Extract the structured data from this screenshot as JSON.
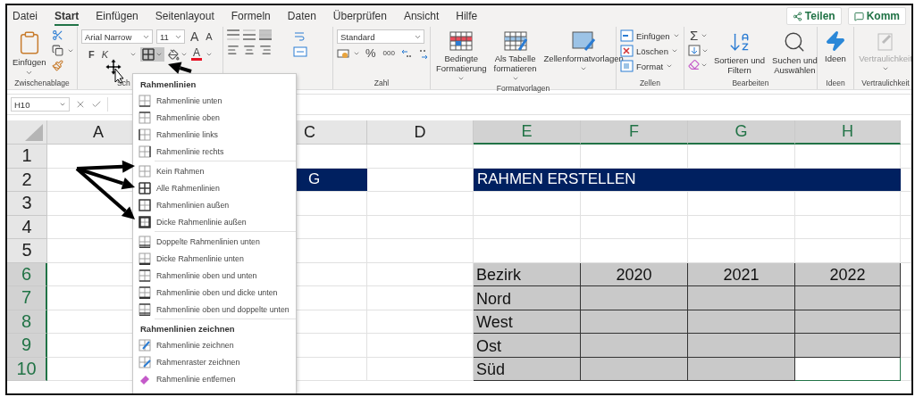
{
  "tabs": [
    {
      "label": "Datei",
      "selected": false
    },
    {
      "label": "Start",
      "selected": true
    },
    {
      "label": "Einfügen",
      "selected": false
    },
    {
      "label": "Seitenlayout",
      "selected": false
    },
    {
      "label": "Formeln",
      "selected": false
    },
    {
      "label": "Daten",
      "selected": false
    },
    {
      "label": "Überprüfen",
      "selected": false
    },
    {
      "label": "Ansicht",
      "selected": false
    },
    {
      "label": "Hilfe",
      "selected": false
    }
  ],
  "share": {
    "share_button": "Teilen",
    "comments_button": "Komm"
  },
  "ribbon": {
    "clipboard": {
      "paste": "Einfügen",
      "label": "Zwischenablage"
    },
    "font": {
      "font_name": "Arial Narrow",
      "font_size": "11",
      "grow": "A",
      "shrink": "A",
      "bold": "F",
      "italic": "K",
      "font_color": "A",
      "borders_open": true,
      "label": "Sch"
    },
    "number": {
      "format": "Standard",
      "percent": "%",
      "thousands": "000",
      "label": "Zahl"
    },
    "styles": {
      "buttons": [
        {
          "lines": [
            "Bedingte",
            "Formatierung"
          ],
          "kind": "conditional"
        },
        {
          "lines": [
            "Als Tabelle",
            "formatieren"
          ],
          "kind": "table"
        },
        {
          "lines": [
            "Zellenformatvorlagen"
          ],
          "kind": "cell_styles"
        }
      ],
      "label": "Formatvorlagen"
    },
    "cells": {
      "buttons": [
        {
          "label": "Einfügen",
          "kind": "insert"
        },
        {
          "label": "Löschen",
          "kind": "delete"
        },
        {
          "label": "Format",
          "kind": "format"
        }
      ],
      "label": "Zellen"
    },
    "editing": {
      "sum": "Σ",
      "buttons": [
        {
          "lines": [
            "Sortieren und",
            "Filtern"
          ],
          "kind": "sort"
        },
        {
          "lines": [
            "Suchen und",
            "Auswählen"
          ],
          "kind": "find"
        }
      ],
      "label": "Bearbeiten"
    },
    "ideas": {
      "button": "Ideen",
      "label": "Ideen"
    },
    "sensitivity": {
      "button": "Vertraulichkeit",
      "disabled": true,
      "label": "Vertraulichkeit"
    }
  },
  "formula_bar": {
    "name_box": "H10"
  },
  "sheet": {
    "columns": [
      {
        "label": "A",
        "selected": false
      },
      {
        "label": "C",
        "selected": false
      },
      {
        "label": "D",
        "selected": false
      },
      {
        "label": "E",
        "selected": true
      },
      {
        "label": "F",
        "selected": true
      },
      {
        "label": "G",
        "selected": true
      },
      {
        "label": "H",
        "selected": true
      }
    ],
    "rows": [
      {
        "label": "1",
        "selected": false
      },
      {
        "label": "2",
        "selected": false,
        "cells": [
          {
            "kind": "plain"
          },
          {
            "kind": "title",
            "text": "G"
          },
          {
            "kind": "plain"
          },
          {
            "kind": "band",
            "text": "RAHMEN ERSTELLEN"
          }
        ]
      },
      {
        "label": "3",
        "selected": false
      },
      {
        "label": "4",
        "selected": false
      },
      {
        "label": "5",
        "selected": false
      },
      {
        "label": "6",
        "selected": true,
        "cells": [
          {
            "kind": "plain"
          },
          {
            "kind": "plain"
          },
          {
            "kind": "plain"
          },
          {
            "kind": "table",
            "text": "Bezirk"
          },
          {
            "kind": "table_head",
            "text": "2020"
          },
          {
            "kind": "table_head",
            "text": "2021"
          },
          {
            "kind": "table_head",
            "text": "2022"
          }
        ]
      },
      {
        "label": "7",
        "selected": true,
        "cells": [
          {
            "kind": "plain"
          },
          {
            "kind": "plain"
          },
          {
            "kind": "plain"
          },
          {
            "kind": "table",
            "text": "Nord"
          },
          {
            "kind": "table"
          },
          {
            "kind": "table"
          },
          {
            "kind": "table"
          }
        ]
      },
      {
        "label": "8",
        "selected": true,
        "cells": [
          {
            "kind": "plain"
          },
          {
            "kind": "plain"
          },
          {
            "kind": "plain"
          },
          {
            "kind": "table",
            "text": "West"
          },
          {
            "kind": "table"
          },
          {
            "kind": "table"
          },
          {
            "kind": "table"
          }
        ]
      },
      {
        "label": "9",
        "selected": true,
        "cells": [
          {
            "kind": "plain"
          },
          {
            "kind": "plain"
          },
          {
            "kind": "plain"
          },
          {
            "kind": "table",
            "text": "Ost"
          },
          {
            "kind": "table"
          },
          {
            "kind": "table"
          },
          {
            "kind": "table"
          }
        ]
      },
      {
        "label": "10",
        "selected": true,
        "cells": [
          {
            "kind": "plain"
          },
          {
            "kind": "plain"
          },
          {
            "kind": "plain"
          },
          {
            "kind": "table",
            "text": "Süd"
          },
          {
            "kind": "table"
          },
          {
            "kind": "table"
          },
          {
            "kind": "active"
          }
        ]
      }
    ]
  },
  "border_menu": {
    "sections": [
      {
        "title": "Rahmenlinien",
        "items": [
          {
            "label": "Rahmenlinie unten",
            "kind": "bottom"
          },
          {
            "label": "Rahmenlinie oben",
            "kind": "top"
          },
          {
            "label": "Rahmenlinie links",
            "kind": "left"
          },
          {
            "label": "Rahmenlinie rechts",
            "kind": "right"
          }
        ]
      },
      {
        "items": [
          {
            "label": "Kein Rahmen",
            "kind": "none"
          },
          {
            "label": "Alle Rahmenlinien",
            "kind": "all"
          },
          {
            "label": "Rahmenlinien außen",
            "kind": "outside"
          },
          {
            "label": "Dicke Rahmenlinie außen",
            "kind": "thick_outside"
          }
        ]
      },
      {
        "items": [
          {
            "label": "Doppelte Rahmenlinien unten",
            "kind": "double_bottom"
          },
          {
            "label": "Dicke Rahmenlinie unten",
            "kind": "thick_bottom"
          },
          {
            "label": "Rahmenlinie oben und unten",
            "kind": "top_bottom"
          },
          {
            "label": "Rahmenlinie oben und dicke unten",
            "kind": "top_thick_bottom"
          },
          {
            "label": "Rahmenlinie oben und doppelte unten",
            "kind": "top_double_bottom"
          }
        ]
      },
      {
        "title": "Rahmenlinien zeichnen",
        "items": [
          {
            "label": "Rahmenlinie zeichnen",
            "kind": "draw"
          },
          {
            "label": "Rahmenraster zeichnen",
            "kind": "draw_grid"
          },
          {
            "label": "Rahmenlinie entfernen",
            "kind": "erase"
          }
        ]
      }
    ]
  }
}
